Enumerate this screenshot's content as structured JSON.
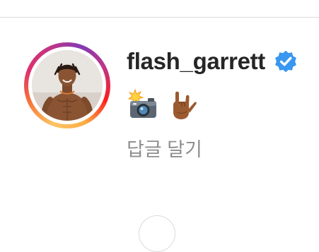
{
  "comment": {
    "username": "flash_garrett",
    "verified": true,
    "emojis": [
      {
        "name": "camera-with-flash",
        "icon": "camera-flash-icon"
      },
      {
        "name": "love-you-gesture",
        "icon": "love-you-hand-icon"
      }
    ],
    "reply_label": "답글 달기"
  },
  "colors": {
    "username_text": "#262626",
    "reply_text": "#8e8e8e",
    "verified_blue": "#3897f0",
    "story_ring": [
      "#fdc468",
      "#f77737",
      "#e1306c",
      "#c13584",
      "#833ab4"
    ]
  }
}
